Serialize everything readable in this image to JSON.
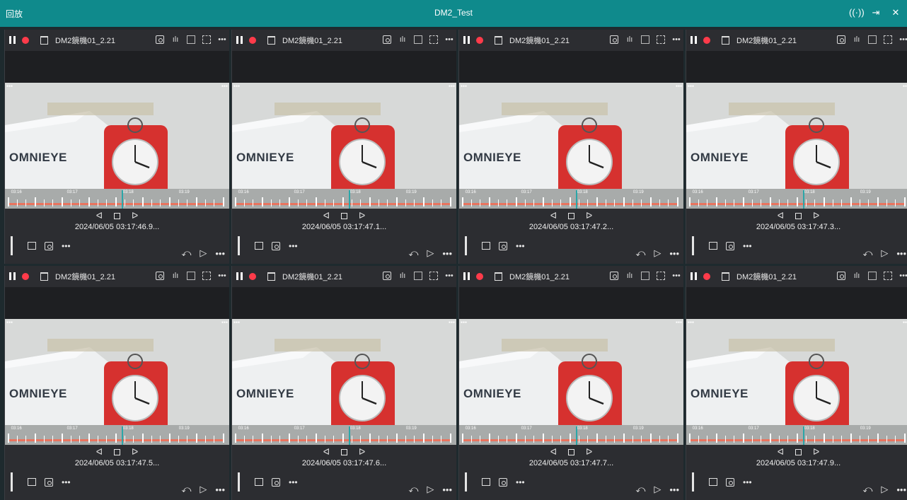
{
  "app": {
    "mode_label": "回放",
    "window_title": "DM2_Test",
    "controls": [
      "broadcast-icon",
      "export-icon",
      "close-icon"
    ],
    "accent_color": "#0f8a8c"
  },
  "tiles": [
    {
      "camera_name": "DM2鏡機01_2.21",
      "timestamp": "2024/06/05 03:17:46.9...",
      "playhead": 0.53
    },
    {
      "camera_name": "DM2鏡機01_2.21",
      "timestamp": "2024/06/05 03:17:47.1...",
      "playhead": 0.53
    },
    {
      "camera_name": "DM2鏡機01_2.21",
      "timestamp": "2024/06/05 03:17:47.2...",
      "playhead": 0.53
    },
    {
      "camera_name": "DM2鏡機01_2.21",
      "timestamp": "2024/06/05 03:17:47.3...",
      "playhead": 0.53
    },
    {
      "camera_name": "DM2鏡機01_2.21",
      "timestamp": "2024/06/05 03:17:47.5...",
      "playhead": 0.53
    },
    {
      "camera_name": "DM2鏡機01_2.21",
      "timestamp": "2024/06/05 03:17:47.6...",
      "playhead": 0.53
    },
    {
      "camera_name": "DM2鏡機01_2.21",
      "timestamp": "2024/06/05 03:17:47.7...",
      "playhead": 0.53
    },
    {
      "camera_name": "DM2鏡機01_2.21",
      "timestamp": "2024/06/05 03:17:47.9...",
      "playhead": 0.53
    }
  ],
  "timeline_labels": [
    "03:16",
    "03:17",
    "03:18",
    "03:19"
  ],
  "video_brand": "OMNIEYE",
  "status_colors": {
    "record": "#ff3b4a",
    "timeline": "#e8745f",
    "playhead": "#2ba6a8"
  }
}
